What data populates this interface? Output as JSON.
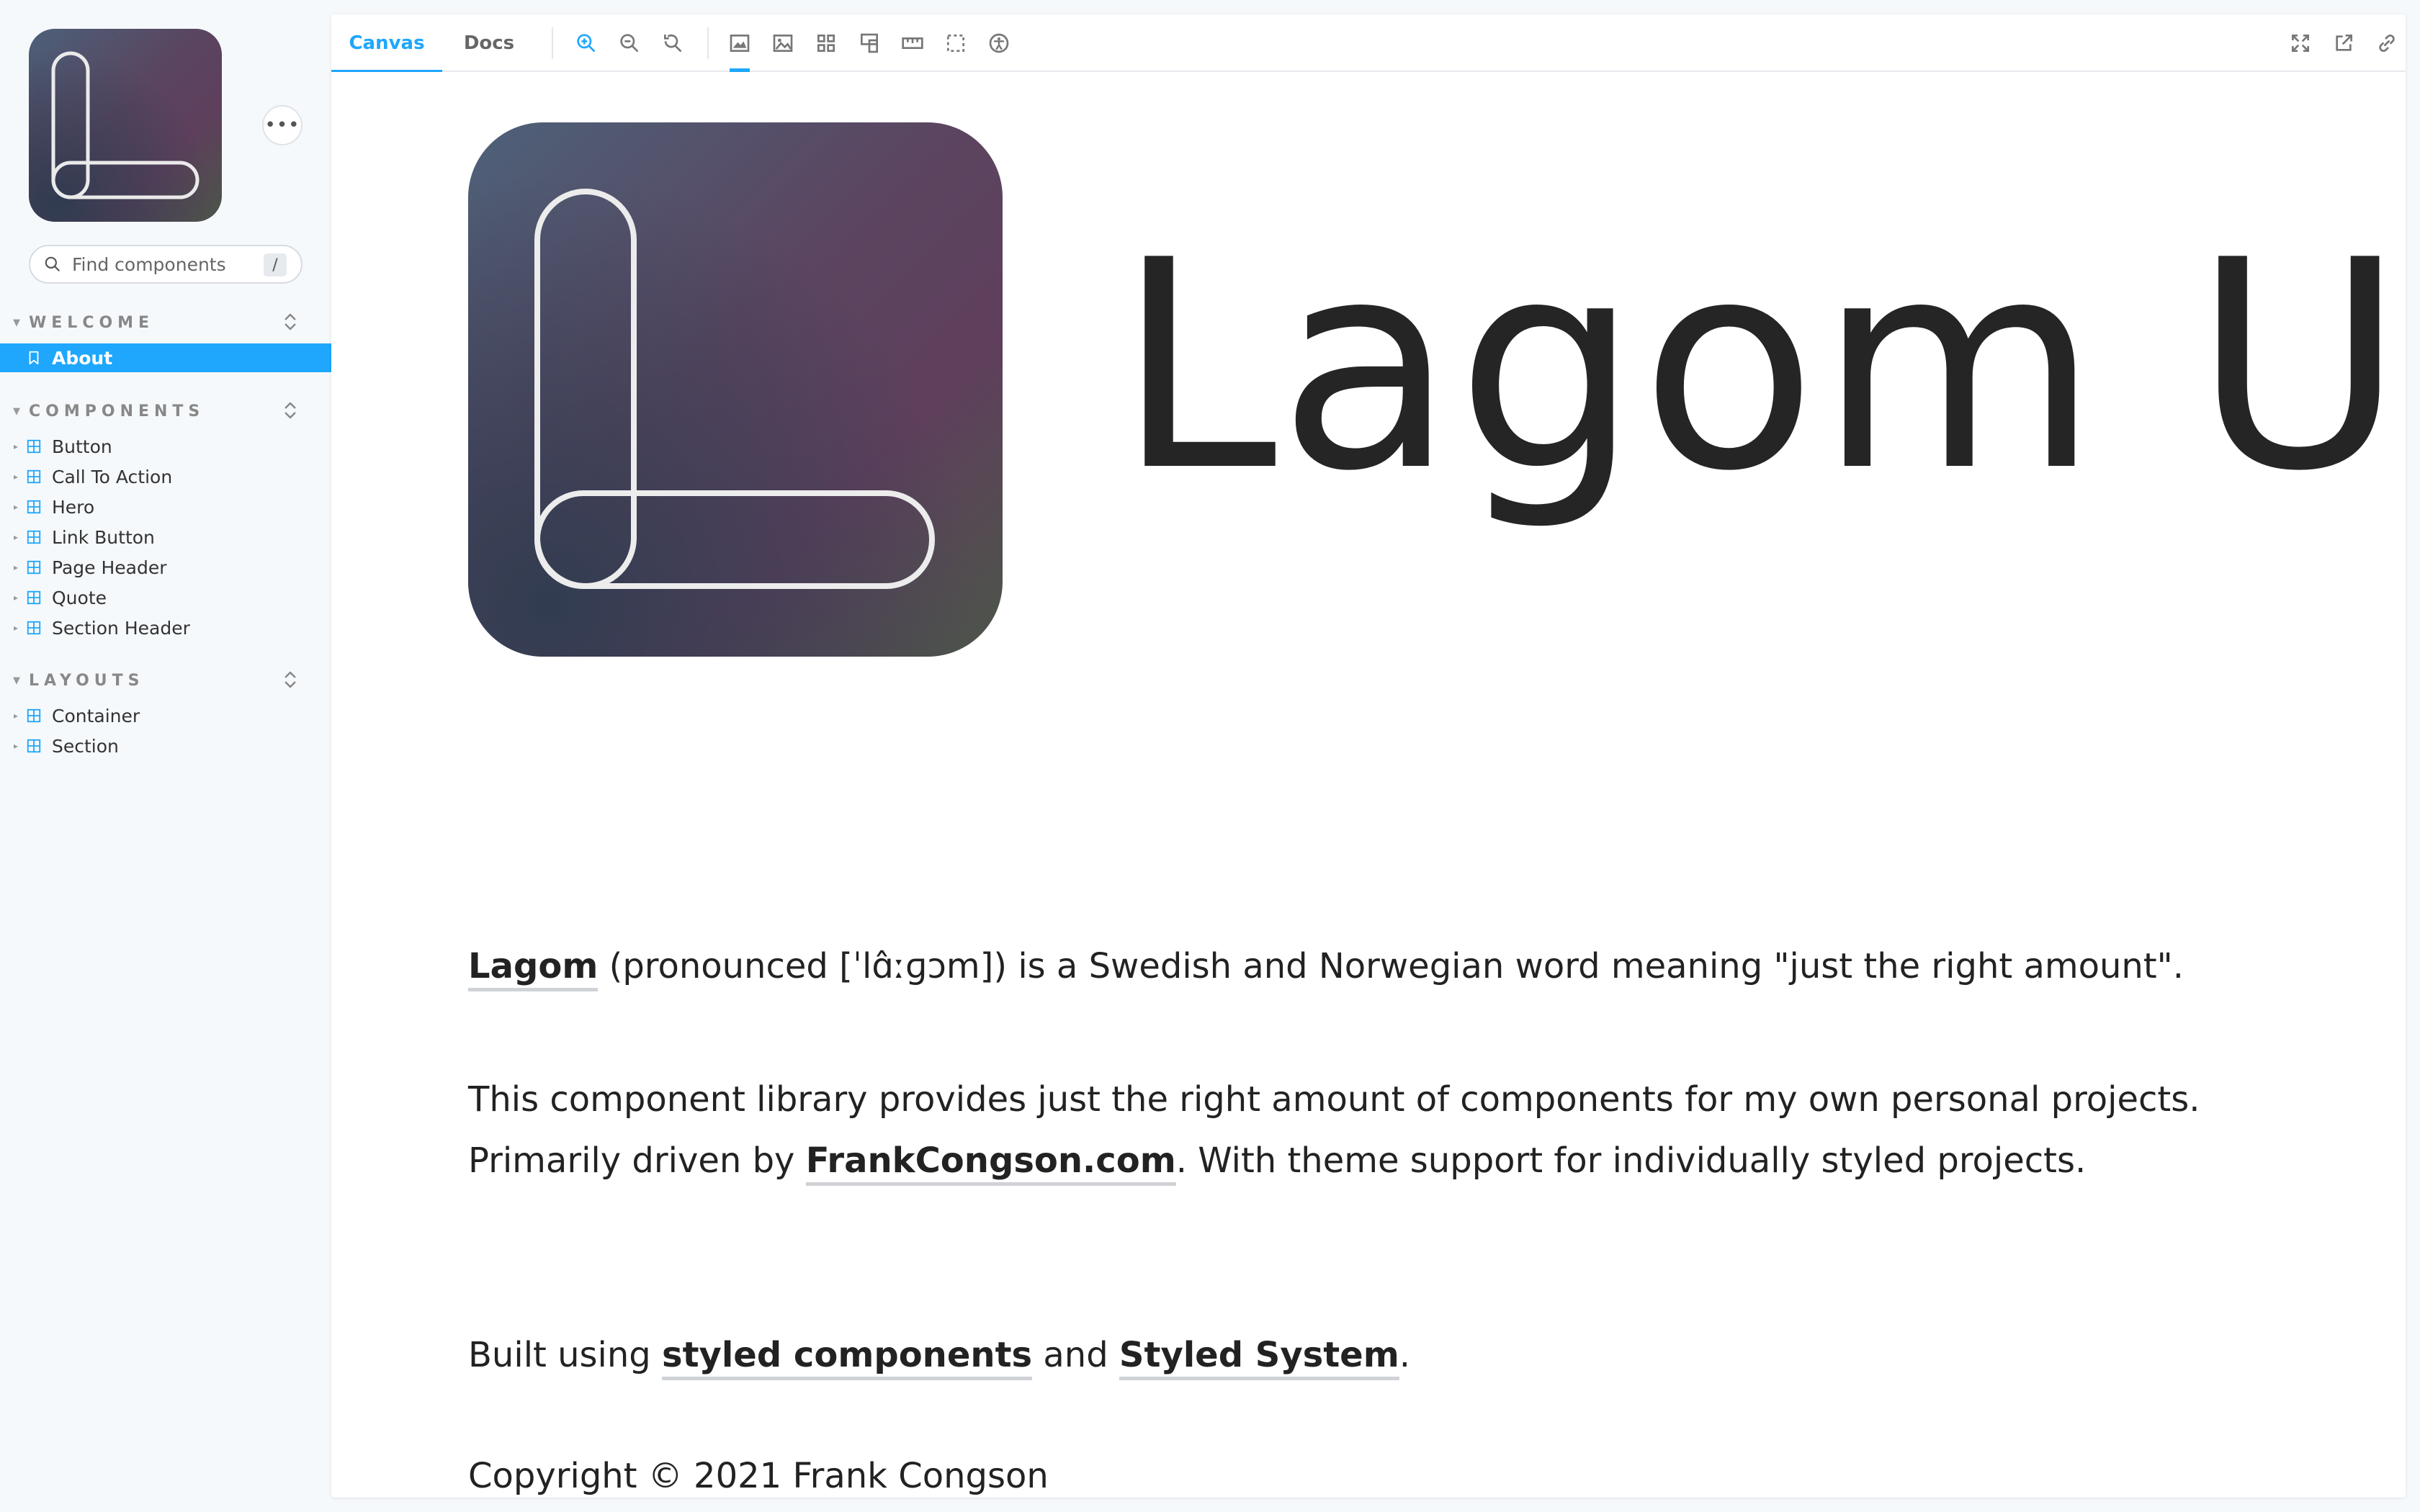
{
  "sidebar": {
    "menu_label": "•••",
    "search": {
      "placeholder": "Find components",
      "shortcut": "/"
    },
    "sections": [
      {
        "title": "WELCOME",
        "items": [
          {
            "label": "About",
            "icon": "bookmark-icon",
            "active": true
          }
        ]
      },
      {
        "title": "COMPONENTS",
        "items": [
          {
            "label": "Button"
          },
          {
            "label": "Call To Action"
          },
          {
            "label": "Hero"
          },
          {
            "label": "Link Button"
          },
          {
            "label": "Page Header"
          },
          {
            "label": "Quote"
          },
          {
            "label": "Section Header"
          }
        ]
      },
      {
        "title": "LAYOUTS",
        "items": [
          {
            "label": "Container"
          },
          {
            "label": "Section"
          }
        ]
      }
    ]
  },
  "toolbar": {
    "tabs": [
      {
        "label": "Canvas",
        "active": true
      },
      {
        "label": "Docs",
        "active": false
      }
    ],
    "tools": [
      "zoom-in-icon",
      "zoom-out-icon",
      "reset-zoom-icon",
      "background-icon",
      "image-icon",
      "grid-icon",
      "viewport-icon",
      "measure-icon",
      "outline-icon",
      "accessibility-icon"
    ],
    "right_tools": [
      "fullscreen-icon",
      "open-new-tab-icon",
      "copy-link-icon"
    ]
  },
  "canvas": {
    "hero_title": "Lagom UI",
    "p1": {
      "term": "Lagom",
      "rest": " (pronounced [ˈlɑ̂ːɡɔm]) is a Swedish and Norwegian word meaning \"just the right amount\"."
    },
    "p2": {
      "before": "This component library provides just the right amount of components for my own personal projects. Primarily driven by ",
      "link": "FrankCongson.com",
      "after": ". With theme support for individually styled projects."
    },
    "p3": {
      "before": "Built using ",
      "link1": "styled components",
      "mid": " and ",
      "link2": "Styled System",
      "after": "."
    },
    "copyright": "Copyright © 2021 Frank Congson"
  },
  "colors": {
    "accent": "#1ea7fd",
    "text": "#222222",
    "sidebar_bg": "#f6f9fc"
  }
}
